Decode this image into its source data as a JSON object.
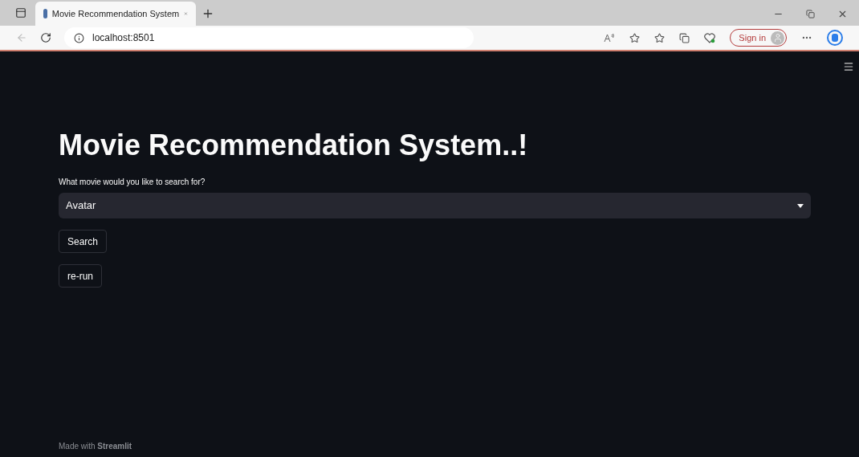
{
  "browser": {
    "tab": {
      "title": "Movie Recommendation System",
      "selected": true
    },
    "address": "localhost:8501",
    "sign_in": "Sign in"
  },
  "page": {
    "title": "Movie Recommendation System..!",
    "select_label": "What movie would you like to search for?",
    "select_value": "Avatar",
    "buttons": [
      "Search",
      "re-run"
    ],
    "footer": "Made with **Streamlit**"
  }
}
